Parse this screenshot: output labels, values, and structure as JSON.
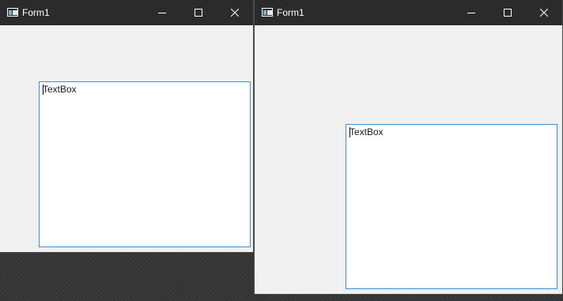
{
  "windows": [
    {
      "title": "Form1",
      "textbox": {
        "text": "TextBox"
      }
    },
    {
      "title": "Form1",
      "textbox": {
        "text": "TextBox"
      }
    }
  ],
  "icons": {
    "app": "form-app-icon",
    "minimize": "minimize-icon",
    "maximize": "maximize-icon",
    "close": "close-icon"
  },
  "colors": {
    "titlebar": "#2b2b2b",
    "client": "#f0f0f0",
    "textbox_border": "#3c8fd6",
    "desktop": "#383838"
  }
}
